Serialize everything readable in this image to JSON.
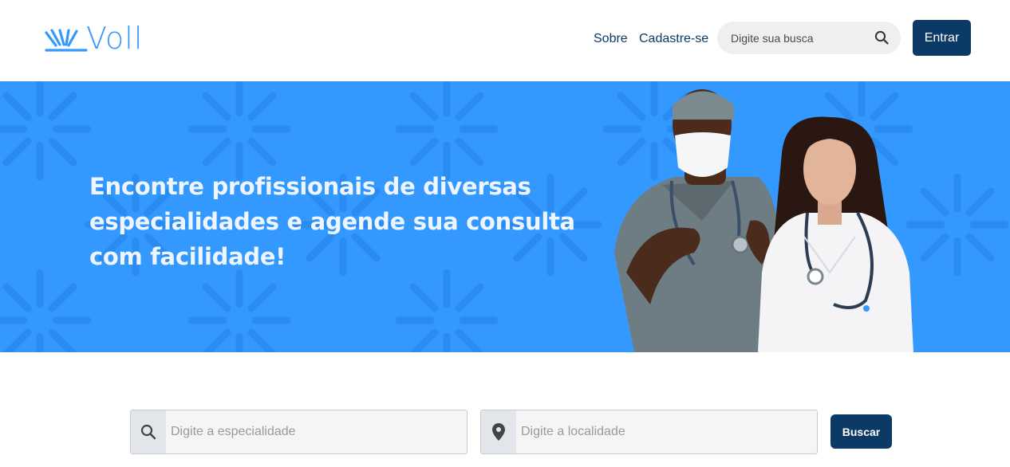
{
  "header": {
    "brand": "Voll",
    "nav": [
      {
        "label": "Sobre"
      },
      {
        "label": "Cadastre-se"
      }
    ],
    "search": {
      "placeholder": "Digite sua busca",
      "value": ""
    },
    "login_label": "Entrar"
  },
  "banner": {
    "title": "Encontre profissionais de diversas especialidades e agende sua consulta com facilidade!"
  },
  "search_form": {
    "specialty": {
      "placeholder": "Digite a especialidade",
      "value": "",
      "icon": "search-icon"
    },
    "location": {
      "placeholder": "Digite a localidade",
      "value": "",
      "icon": "map-pin-icon"
    },
    "submit_label": "Buscar"
  },
  "colors": {
    "primary": "#3399ff",
    "navy": "#0b3a66"
  }
}
